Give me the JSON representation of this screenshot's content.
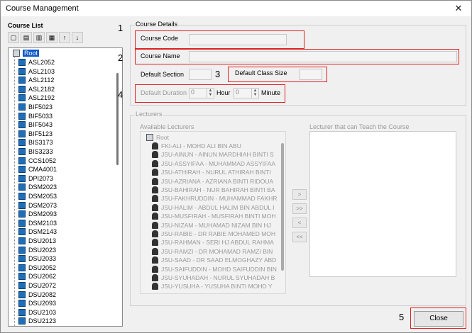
{
  "window": {
    "title": "Course Management",
    "close_glyph": "✕"
  },
  "course_list": {
    "title": "Course List",
    "toolbar": [
      "new-icon",
      "book-icon",
      "delete-icon",
      "print-icon",
      "move-up-icon",
      "move-down-icon"
    ],
    "toolbar_glyphs": [
      "▢",
      "▤",
      "▥",
      "▦",
      "↑",
      "↓"
    ],
    "root": "Root",
    "items": [
      "ASL2052",
      "ASL2103",
      "ASL2112",
      "ASL2182",
      "ASL2192",
      "BIF5023",
      "BIF5033",
      "BIF5043",
      "BIF5123",
      "BIS3173",
      "BIS3233",
      "CCS1052",
      "CMA4001",
      "DPI2073",
      "DSM2023",
      "DSM2053",
      "DSM2073",
      "DSM2093",
      "DSM2103",
      "DSM2143",
      "DSU2013",
      "DSU2023",
      "DSU2033",
      "DSU2052",
      "DSU2062",
      "DSU2072",
      "DSU2082",
      "DSU2093",
      "DSU2103",
      "DSU2123"
    ]
  },
  "course_details": {
    "group_label": "Course Details",
    "course_code_label": "Course Code",
    "course_code_value": "",
    "course_name_label": "Course Name",
    "course_name_value": "",
    "default_section_label": "Default Section",
    "default_section_value": "",
    "default_class_size_label": "Default Class Size",
    "default_class_size_value": "",
    "default_duration_label": "Default Duration",
    "duration_hour_value": "0",
    "hour_label": "Hour",
    "duration_minute_value": "0",
    "minute_label": "Minute"
  },
  "annotations": [
    "1",
    "2",
    "3",
    "4",
    "5"
  ],
  "lecturers": {
    "group_label": "Lecturers",
    "available_label": "Available Lecturers",
    "assigned_label": "Lecturer that can Teach the Course",
    "root": "Root",
    "available": [
      "FKI-ALI - MOHD ALI BIN ABU",
      "JSU-AINUN - AINUN MARDHIAH BINTI S",
      "JSU-ASSYIFAA - MUHAMMAD ASSYIFAA",
      "JSU-ATHIRAH - NURUL ATHIRAH BINTI",
      "JSU-AZRIANA - AZRIANA BINTI RIDOUA",
      "JSU-BAHIRAH - NUR BAHIRAH BINTI BA",
      "JSU-FAKHRUDDIN - MUHAMMAD FAKHR",
      "JSU-HALIM - ABDUL HALIM BIN ABDUL I",
      "JSU-MUSFIRAH - MUSFIRAH BINTI MOH",
      "JSU-NIZAM - MUHAMAD NIZAM BIN HJ",
      "JSU-RABIE - DR RABIE MOHAMED MOH",
      "JSU-RAHMAN - SERI HJ ABDUL RAHMA",
      "JSU-RAMZI - DR MOHAMAD RAMZI BIN",
      "JSU-SAAD - DR SAAD ELMOGHAZY ABD",
      "JSU-SAIFUDDIN - MOHD SAIFUDDIN BIN",
      "JSU-SYUHADAH - NURUL SYUHADAH B",
      "JSU-YUSUHA - YUSUHA BINTI MOHD Y"
    ],
    "assigned": [],
    "add_label": ">",
    "add_all_label": ">>",
    "remove_label": "<",
    "remove_all_label": "<<"
  },
  "close_label": "Close"
}
